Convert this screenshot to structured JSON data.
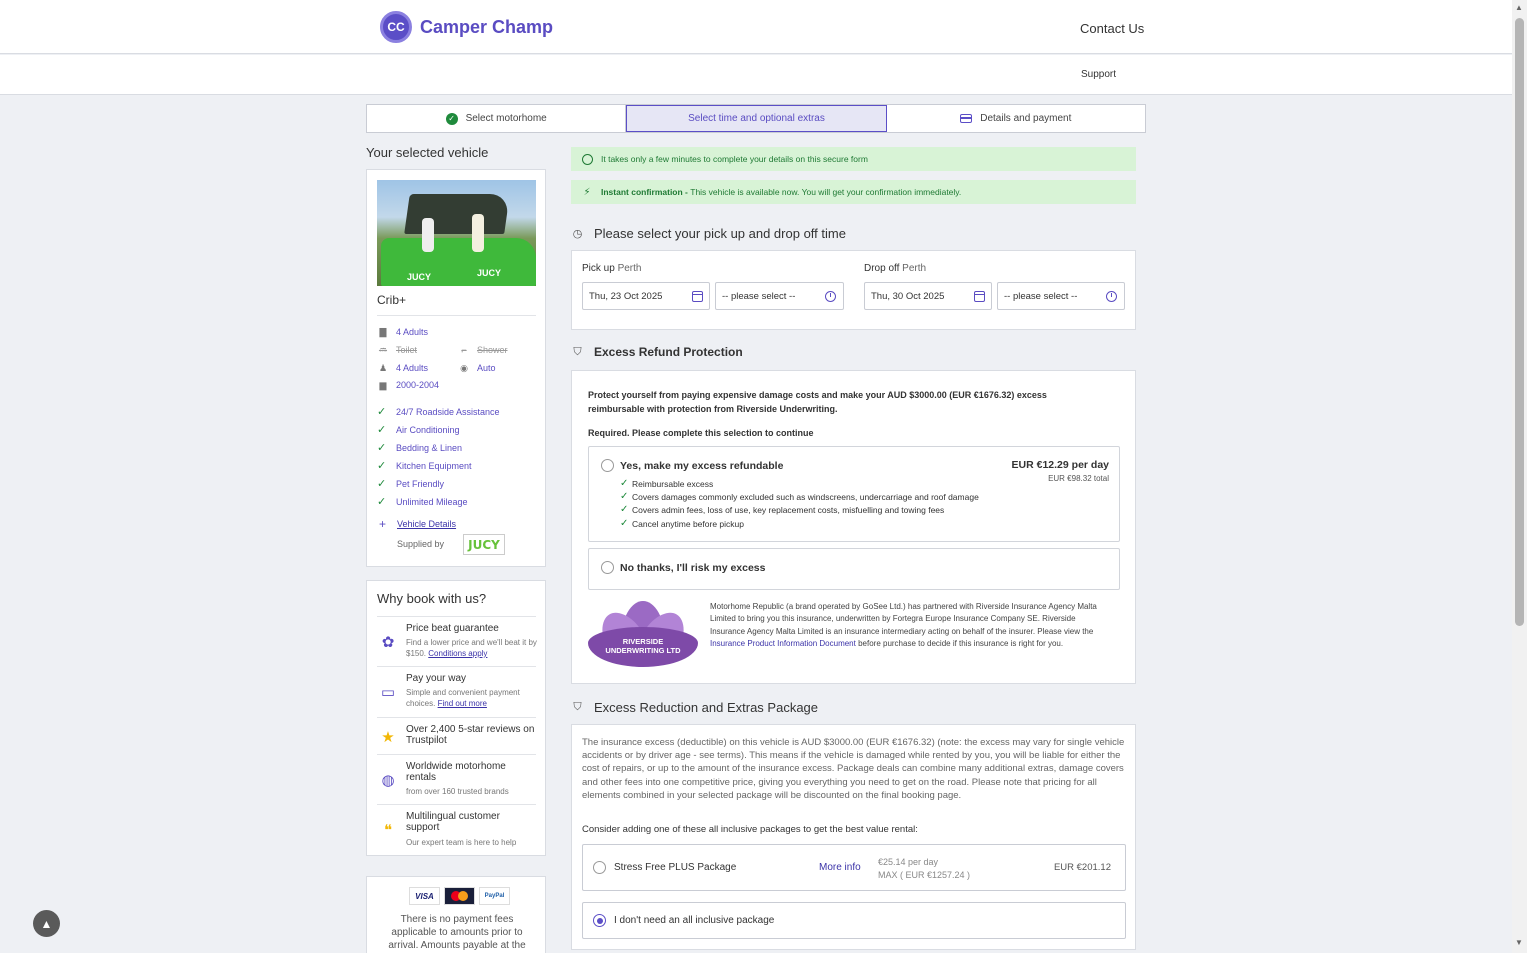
{
  "header": {
    "logo_mark": "CC",
    "logo_text": "Camper Champ",
    "contact": "Contact Us",
    "support": "Support"
  },
  "steps": [
    {
      "label": "Select motorhome",
      "state": "done"
    },
    {
      "label": "Select time and optional extras",
      "state": "active"
    },
    {
      "label": "Details and payment",
      "state": "pending"
    }
  ],
  "vehicle": {
    "section_title": "Your selected vehicle",
    "name": "Crib+",
    "image_logo_1": "JUCY",
    "image_logo_2": "JUCY",
    "specs": {
      "adults_1": "4 Adults",
      "toilet": "Toilet",
      "shower": "Shower",
      "adults_2": "4 Adults",
      "transmission": "Auto",
      "years": "2000-2004"
    },
    "features": [
      "24/7 Roadside Assistance",
      "Air Conditioning",
      "Bedding & Linen",
      "Kitchen Equipment",
      "Pet Friendly",
      "Unlimited Mileage"
    ],
    "details_link": "Vehicle Details",
    "supplied_by": "Supplied by",
    "supplier": "JUCY"
  },
  "why": {
    "title": "Why book with us?",
    "items": [
      {
        "title": "Price beat guarantee",
        "sub": "Find a lower price and we'll beat it by $150.",
        "link": "Conditions apply"
      },
      {
        "title": "Pay your way",
        "sub": "Simple and convenient payment choices.",
        "link": "Find out more"
      },
      {
        "title": "Over 2,400 5-star reviews on Trustpilot",
        "sub": "",
        "link": ""
      },
      {
        "title": "Worldwide motorhome rentals",
        "sub": "from over 160 trusted brands",
        "link": ""
      },
      {
        "title": "Multilingual customer support",
        "sub": "Our expert team is here to help",
        "link": ""
      }
    ]
  },
  "payment": {
    "visa": "VISA",
    "paypal": "PayPal",
    "text": "There is no payment fees applicable to amounts prior to arrival. Amounts payable at the"
  },
  "banners": {
    "secure": "It takes only a few minutes to complete your details on this secure form",
    "instant_bold": "Instant confirmation - ",
    "instant_text": "This vehicle is available now. You will get your confirmation immediately."
  },
  "times": {
    "section_title": "Please select your pick up and drop off time",
    "pickup_label": "Pick up",
    "pickup_loc": "Perth",
    "pickup_date": "Thu, 23 Oct 2025",
    "pickup_time": "-- please select --",
    "dropoff_label": "Drop off",
    "dropoff_loc": "Perth",
    "dropoff_date": "Thu, 30 Oct 2025",
    "dropoff_time": "-- please select --"
  },
  "erp": {
    "section_title": "Excess Refund Protection",
    "intro": "Protect yourself from paying expensive damage costs and make your AUD $3000.00 (EUR €1676.32) excess reimbursable with protection from Riverside Underwriting.",
    "required": "Required. Please complete this selection to continue",
    "yes_title": "Yes, make my excess refundable",
    "yes_price": "EUR €12.29 per day",
    "yes_total": "EUR €98.32 total",
    "yes_features": [
      "Reimbursable excess",
      "Covers damages commonly excluded such as windscreens, undercarriage and roof damage",
      "Covers admin fees, loss of use, key replacement costs, misfuelling and towing fees",
      "Cancel anytime before pickup"
    ],
    "no_title": "No thanks, I'll risk my excess",
    "logo_line1": "RIVERSIDE",
    "logo_line2": "UNDERWRITING LTD",
    "desc_1": "Motorhome Republic (a brand operated by GoSee Ltd.) has partnered with Riverside Insurance Agency Malta Limited to bring you this insurance, underwritten by Fortegra Europe Insurance Company SE. Riverside Insurance Agency Malta Limited is an insurance intermediary acting on behalf of the insurer. Please view the ",
    "desc_link": "Insurance Product Information Document",
    "desc_2": " before purchase to decide if this insurance is right for you."
  },
  "erx": {
    "section_title": "Excess Reduction and Extras Package",
    "text": "The insurance excess (deductible) on this vehicle is AUD $3000.00 (EUR €1676.32) (note: the excess may vary for single vehicle accidents or by driver age - see terms). This means if the vehicle is damaged while rented by you, you will be liable for either the cost of repairs, or up to the amount of the insurance excess. Package deals can combine many additional extras, damage covers and other fees into one competitive price, giving you everything you need to get on the road. Please note that pricing for all elements combined in your selected package will be discounted on the final booking page.",
    "cta": "Consider adding one of these all inclusive packages to get the best value rental:",
    "pkg_name": "Stress Free PLUS Package",
    "pkg_more": "More info",
    "pkg_per_day": "€25.14 per day",
    "pkg_max": "MAX ( EUR €1257.24 )",
    "pkg_total": "EUR €201.12",
    "none_name": "I don't need an all inclusive package"
  },
  "colors": {
    "brand": "#5b4ec7",
    "success": "#1f8a3c",
    "banner_bg": "#d8f3d6"
  }
}
